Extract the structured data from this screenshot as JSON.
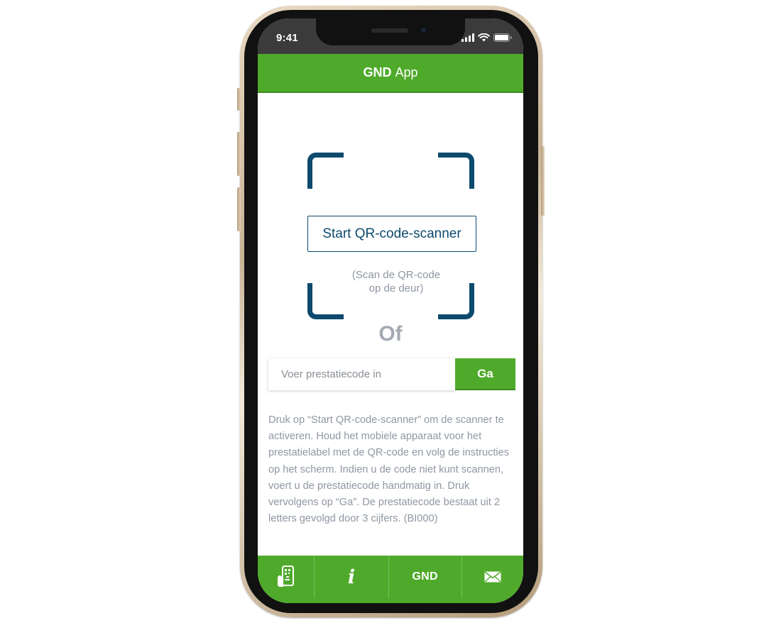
{
  "status_bar": {
    "time": "9:41"
  },
  "header": {
    "brand": "GND",
    "title": "App"
  },
  "scanner": {
    "start_label": "Start QR-code-scanner",
    "hint": "(Scan de QR-code\nop de deur)"
  },
  "divider": {
    "or_label": "Of"
  },
  "code_entry": {
    "placeholder": "Voer prestatiecode in",
    "value": "",
    "go_label": "Ga"
  },
  "instructions": {
    "text": "Druk op “Start QR-code-scanner” om de scanner te activeren. Houd het mobiele apparaat voor het prestatielabel met de QR-code en volg de instructies op het scherm. Indien u de code niet kunt scannen, voert u de prestatiecode handmatig in. Druk vervolgens op “Ga”. De prestatiecode bestaat uit 2 letters gevolgd door 3 cijfers. (BI000)"
  },
  "tab_bar": {
    "items": [
      {
        "icon": "phone-qr-scan-icon"
      },
      {
        "icon": "info-icon",
        "glyph": "i"
      },
      {
        "label": "GND"
      },
      {
        "icon": "mail-icon"
      }
    ]
  },
  "colors": {
    "brand_green": "#4faa2b",
    "brand_green_dark": "#3d8a20",
    "accent_blue": "#0e4a6e",
    "muted_text": "#8f97a3",
    "or_text": "#a4aab3",
    "status_bar_bg": "#3b3b3b"
  }
}
